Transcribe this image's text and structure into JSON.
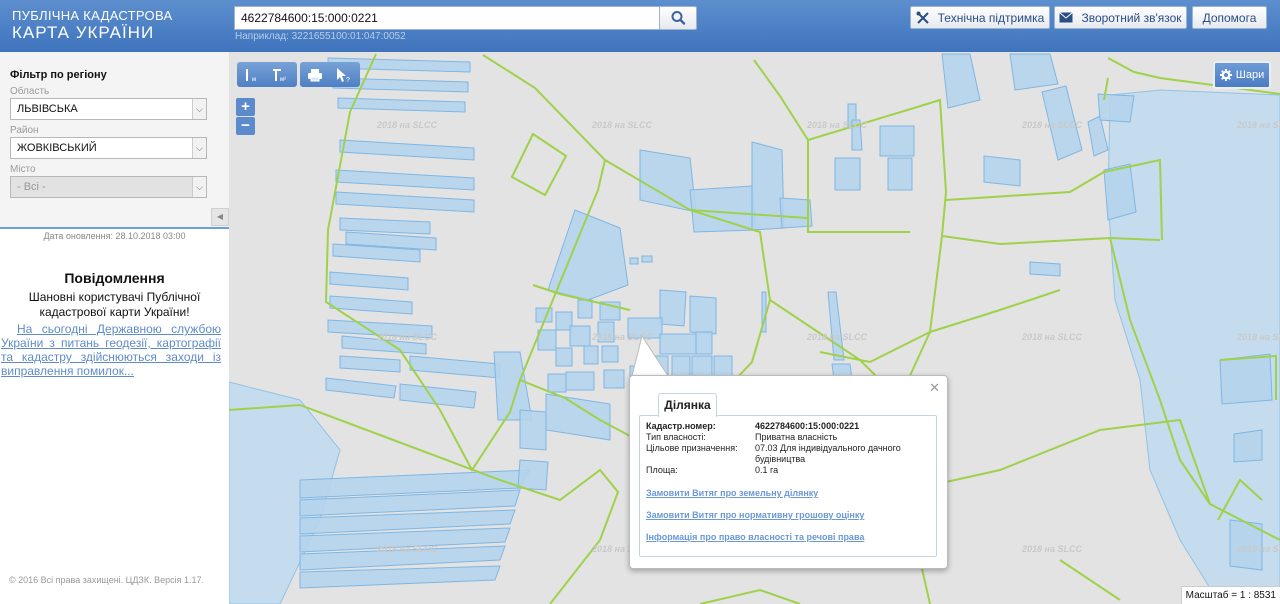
{
  "header": {
    "logo_line1": "ПУБЛІЧНА КАДАСТРОВА",
    "logo_line2": "КАРТА УКРАЇНИ",
    "search_value": "4622784600:15:000:0221",
    "search_hint": "Наприклад: 3221655100:01:047:0052",
    "support_label": "Технічна підтримка",
    "feedback_label": "Зворотний зв'язок",
    "help_label": "Допомога"
  },
  "sidebar": {
    "filter_title": "Фільтр по регіону",
    "oblast_label": "Область",
    "oblast_value": "ЛЬВІВСЬКА",
    "rayon_label": "Район",
    "rayon_value": "ЖОВКІВСЬКИЙ",
    "misto_label": "Місто",
    "misto_value": "- Всі -",
    "update_date": "Дата оновлення: 28.10.2018 03:00",
    "notice_title": "Повідомлення",
    "notice_greeting": "Шановні користувачі Публічної кадастрової карти України!",
    "notice_link": "На сьогодні Державною службою України з питань геодезії, картографії та кадастру здійснюються заходи із виправлення помилок...",
    "copyright": "© 2016 Всі права захищені. ЦДЗК. Версія 1.17."
  },
  "map": {
    "layers_label": "Шари",
    "scale_text": "Масштаб = 1 : 8531",
    "watermark": "2018 на SLCC",
    "tools": [
      "ruler-icon",
      "area-measure-icon",
      "print-icon",
      "identify-icon"
    ]
  },
  "popup": {
    "tab_label": "Ділянка",
    "rows": [
      {
        "label": "Кадастр.номер:",
        "value": "4622784600:15:000:0221"
      },
      {
        "label": "Тип власності:",
        "value": "Приватна власність"
      },
      {
        "label": "Цільове призначення:",
        "value": "07.03 Для індивідуального дачного будівництва"
      },
      {
        "label": "Площа:",
        "value": "0.1 га"
      }
    ],
    "links": [
      "Замовити Витяг про земельну ділянку",
      "Замовити Витяг про нормативну грошову оцінку",
      "Інформація про право власності та речові права"
    ]
  },
  "colors": {
    "header": "#4a7fc4",
    "parcel_fill": "#b5d4ec",
    "parcel_stroke": "#7fb6e3",
    "boundary": "#9fd14a",
    "link": "#6b98d6"
  }
}
